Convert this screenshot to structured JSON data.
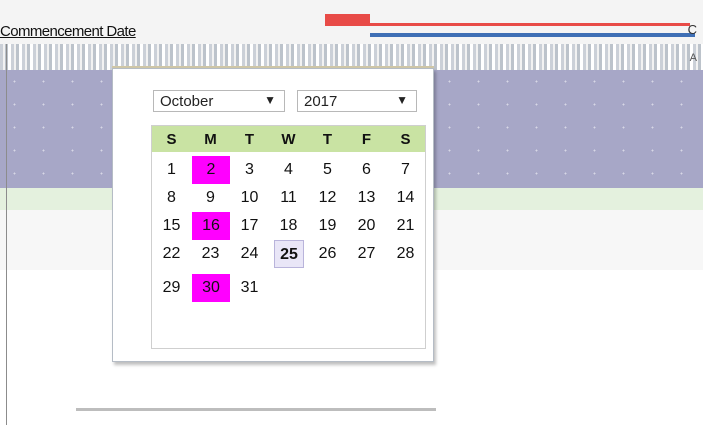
{
  "header": {
    "title": "Commencement Date",
    "right_text": "C"
  },
  "strip": {
    "right_text": "A"
  },
  "datepicker": {
    "month": "October",
    "year": "2017",
    "weekdays": [
      "S",
      "M",
      "T",
      "W",
      "T",
      "F",
      "S"
    ],
    "weeks": [
      [
        "1",
        "2",
        "3",
        "4",
        "5",
        "6",
        "7"
      ],
      [
        "8",
        "9",
        "10",
        "11",
        "12",
        "13",
        "14"
      ],
      [
        "15",
        "16",
        "17",
        "18",
        "19",
        "20",
        "21"
      ],
      [
        "22",
        "23",
        "24",
        "25",
        "26",
        "27",
        "28"
      ],
      [
        "29",
        "30",
        "31"
      ]
    ],
    "highlighted_days": [
      "2",
      "16",
      "30"
    ],
    "today": "25",
    "colors": {
      "highlight": "#ff00ff",
      "weekday_header": "#c9e3a3",
      "today_bg": "#e9e6f7"
    }
  }
}
